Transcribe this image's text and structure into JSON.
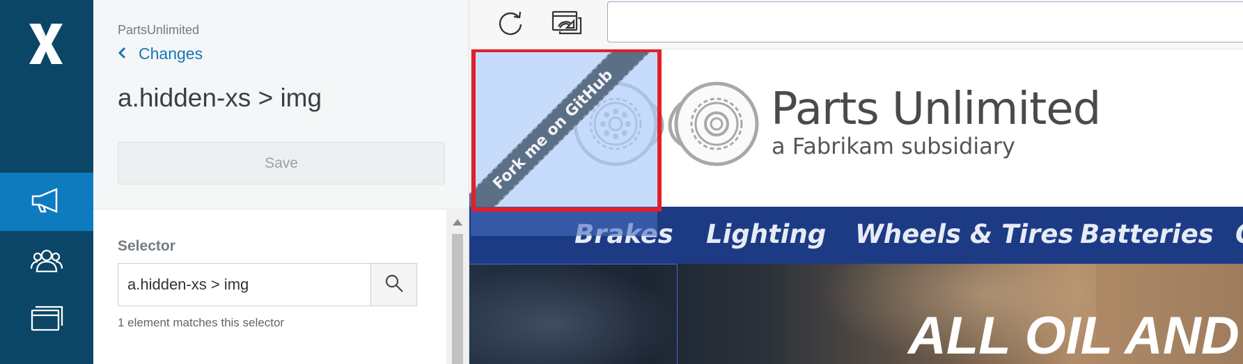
{
  "sidebar_panel": {
    "app_name": "PartsUnlimited",
    "back_label": "Changes",
    "element_title": "a.hidden-xs > img",
    "save_label": "Save",
    "selector_label": "Selector",
    "selector_value": "a.hidden-xs > img",
    "match_text": "1 element matches this selector"
  },
  "rail": {
    "items": [
      "megaphone-icon",
      "users-icon",
      "windows-icon"
    ],
    "active_index": 0
  },
  "website": {
    "ribbon_text": "Fork me on GitHub",
    "brand_name": "Parts Unlimited",
    "brand_subtitle": "a Fabrikam subsidiary",
    "nav_items": [
      "Brakes",
      "Lighting",
      "Wheels & Tires",
      "Batteries",
      "O"
    ],
    "hero_text": "ALL OIL AND L"
  },
  "colors": {
    "rail": "#0b4666",
    "rail_active": "#0f7bbf",
    "link": "#1476b5",
    "nav_bar": "#1c3b84",
    "selection_box": "#e2202c"
  }
}
